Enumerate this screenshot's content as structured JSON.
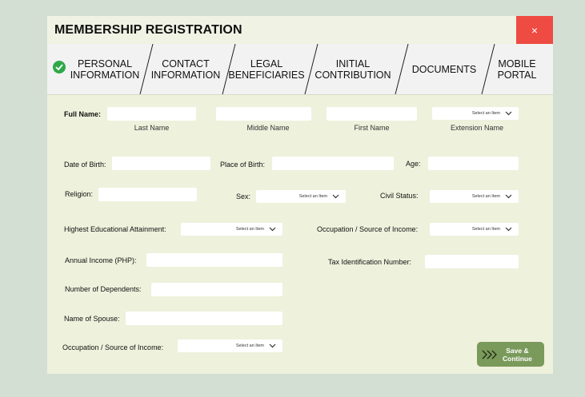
{
  "window": {
    "title": "MEMBERSHIP REGISTRATION",
    "close_label": "×"
  },
  "steps": [
    {
      "line1": "PERSONAL",
      "line2": "INFORMATION",
      "completed": true
    },
    {
      "line1": "CONTACT",
      "line2": "INFORMATION"
    },
    {
      "line1": "LEGAL",
      "line2": "BENEFICIARIES"
    },
    {
      "line1": "INITIAL",
      "line2": "CONTRIBUTION"
    },
    {
      "line1": "DOCUMENTS",
      "line2": ""
    },
    {
      "line1": "MOBILE",
      "line2": "PORTAL"
    }
  ],
  "form": {
    "full_name_label": "Full Name:",
    "last_name_caption": "Last Name",
    "middle_name_caption": "Middle Name",
    "first_name_caption": "First Name",
    "extension_name_caption": "Extension Name",
    "date_of_birth_label": "Date of Birth:",
    "place_of_birth_label": "Place of Birth:",
    "age_label": "Age:",
    "religion_label": "Religion:",
    "sex_label": "Sex:",
    "civil_status_label": "Civil Status:",
    "education_label": "Highest Educational Attainment:",
    "occupation_label": "Occupation / Source of Income:",
    "annual_income_label": "Annual Income (PHP):",
    "tin_label": "Tax Identification Number:",
    "dependents_label": "Number of Dependents:",
    "spouse_label": "Name of Spouse:",
    "spouse_occupation_label": "Occupation / Source of Income:",
    "select_placeholder": "Select an Item"
  },
  "actions": {
    "save_line1": "Save &",
    "save_line2": "Continue"
  },
  "colors": {
    "accent_close": "#ee4b42",
    "save_button": "#7a9a5b",
    "check": "#2fa84a",
    "panel": "#eef1dc",
    "background": "#d3dfd3"
  }
}
